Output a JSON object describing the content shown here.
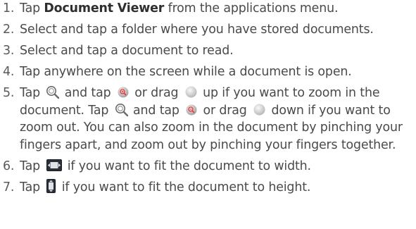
{
  "steps": [
    {
      "num": "1.",
      "parts": {
        "a": "Tap ",
        "bold": "Document Viewer",
        "b": " from the applications menu."
      }
    },
    {
      "num": "2.",
      "text": "Select and tap a folder where you have stored documents."
    },
    {
      "num": "3.",
      "text": "Select and tap a document to read."
    },
    {
      "num": "4.",
      "text": "Tap anywhere on the screen while a document is open."
    },
    {
      "num": "5.",
      "parts": {
        "p1": "Tap ",
        "p2": " and tap ",
        "p3": " or drag ",
        "p4": " up if you want to zoom in the document. Tap ",
        "p5": " and tap ",
        "p6": " or drag ",
        "p7": " down if you want to zoom out. You can also zoom in the document by pinching your fingers apart, and zoom out by pinching your fingers together."
      }
    },
    {
      "num": "6.",
      "parts": {
        "a": "Tap ",
        "b": " if you want to fit the document to width."
      }
    },
    {
      "num": "7.",
      "parts": {
        "a": "Tap ",
        "b": " if you want to fit the document to height."
      }
    }
  ],
  "icons": {
    "zoom_tool": "magnifier-icon",
    "zoom_in": "zoom-in-icon",
    "zoom_out": "zoom-out-icon",
    "slider": "slider-handle-icon",
    "fit_width": "fit-width-icon",
    "fit_height": "fit-height-icon"
  }
}
